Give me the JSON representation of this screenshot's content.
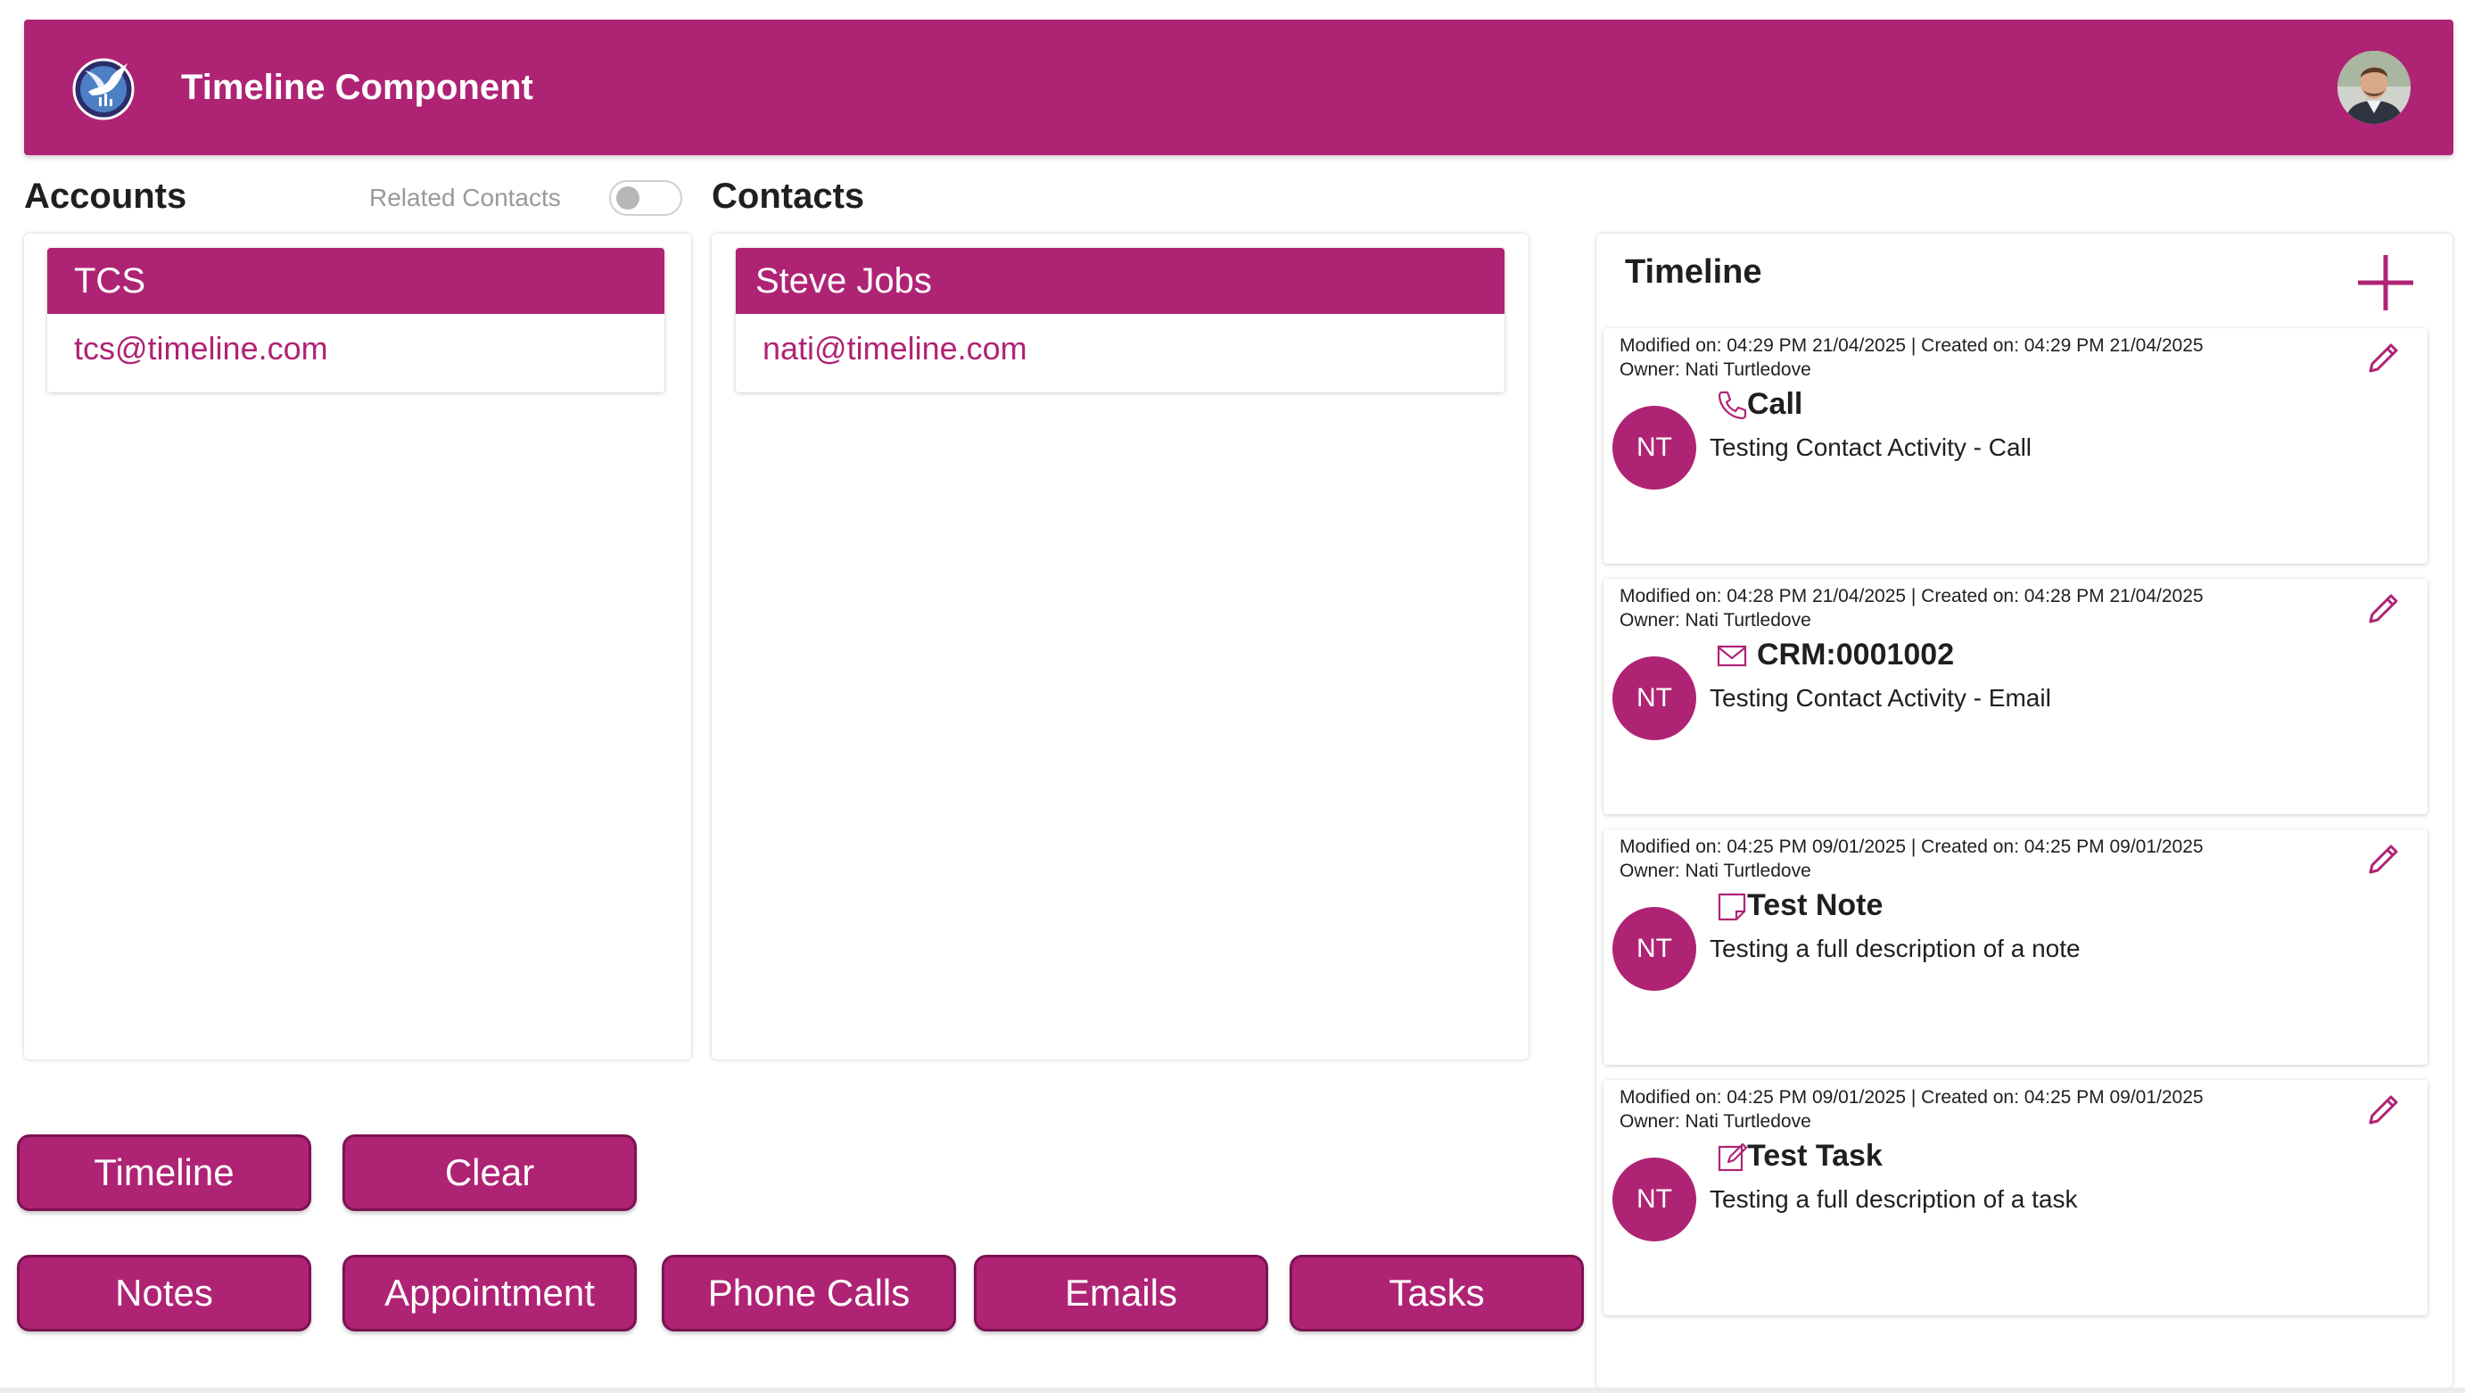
{
  "colors": {
    "brand": "#AF2374",
    "brand_dark": "#7b1352"
  },
  "header": {
    "title": "Timeline Component",
    "logo_icon": "dove-globe-logo",
    "avatar_icon": "user-avatar-photo"
  },
  "accounts": {
    "heading": "Accounts",
    "related_contacts_label": "Related Contacts",
    "related_contacts_on": false,
    "items": [
      {
        "name": "TCS",
        "email": "tcs@timeline.com"
      }
    ]
  },
  "contacts": {
    "heading": "Contacts",
    "items": [
      {
        "name": "Steve Jobs",
        "email": "nati@timeline.com"
      }
    ]
  },
  "buttons": {
    "timeline": "Timeline",
    "clear": "Clear",
    "notes": "Notes",
    "appointment": "Appointment",
    "phone_calls": "Phone Calls",
    "emails": "Emails",
    "tasks": "Tasks"
  },
  "timeline": {
    "title": "Timeline",
    "add_icon": "plus-icon",
    "entries": [
      {
        "meta": "Modified on: 04:29 PM 21/04/2025 | Created on: 04:29 PM 21/04/2025",
        "owner": "Owner: Nati Turtledove",
        "initials": "NT",
        "type_icon": "phone-icon",
        "subject": "Call",
        "description": "Testing Contact Activity - Call"
      },
      {
        "meta": "Modified on: 04:28 PM 21/04/2025 | Created on: 04:28 PM 21/04/2025",
        "owner": "Owner: Nati Turtledove",
        "initials": "NT",
        "type_icon": "envelope-icon",
        "subject": "CRM:0001002",
        "description": "Testing Contact Activity - Email"
      },
      {
        "meta": "Modified on: 04:25 PM 09/01/2025 | Created on: 04:25 PM 09/01/2025",
        "owner": "Owner: Nati Turtledove",
        "initials": "NT",
        "type_icon": "note-icon",
        "subject": "Test Note",
        "description": "Testing a full description of a note"
      },
      {
        "meta": "Modified on: 04:25 PM 09/01/2025 | Created on: 04:25 PM 09/01/2025",
        "owner": "Owner: Nati Turtledove",
        "initials": "NT",
        "type_icon": "task-icon",
        "subject": "Test Task",
        "description": "Testing a full description of a task"
      }
    ]
  }
}
